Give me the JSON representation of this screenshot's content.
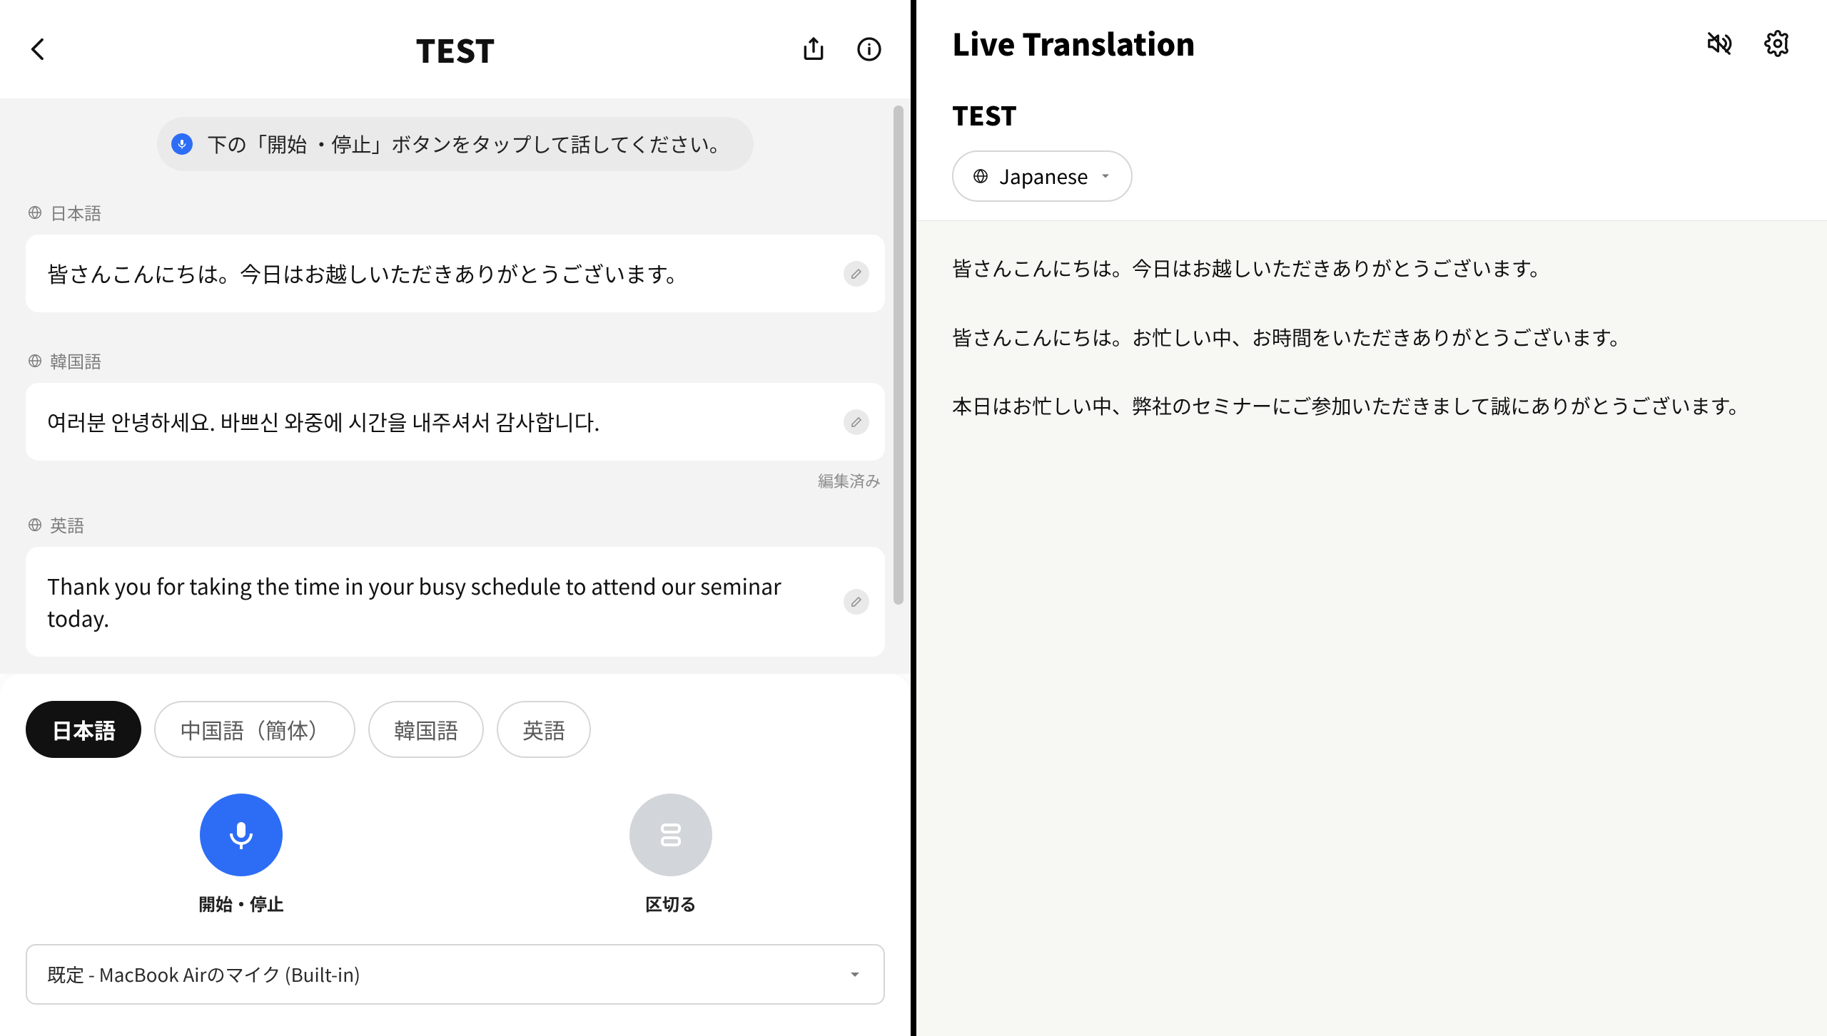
{
  "left": {
    "title": "TEST",
    "hint": "下の「開始 ・停止」ボタンをタップして話してください。",
    "messages": [
      {
        "lang_label": "日本語",
        "text": "皆さんこんにちは。今日はお越しいただきありがとうございます。",
        "edited": false
      },
      {
        "lang_label": "韓国語",
        "text": "여러분 안녕하세요. 바쁘신 와중에 시간을 내주셔서 감사합니다.",
        "edited": true
      },
      {
        "lang_label": "英語",
        "text": "Thank you for taking the time in your busy schedule to attend our seminar today.",
        "edited": false
      }
    ],
    "edited_label": "編集済み",
    "chips": [
      "日本語",
      "中国語（簡体）",
      "韓国語",
      "英語"
    ],
    "active_chip_index": 0,
    "rec_start_stop_label": "開始・停止",
    "rec_segment_label": "区切る",
    "mic_label": "既定 - MacBook Airのマイク (Built-in)"
  },
  "right": {
    "brand": "Live Translation",
    "title": "TEST",
    "language": "Japanese",
    "lines": [
      "皆さんこんにちは。今日はお越しいただきありがとうございます。",
      "皆さんこんにちは。お忙しい中、お時間をいただきありがとうございます。",
      "本日はお忙しい中、弊社のセミナーにご参加いただきまして誠にありがとうございます。"
    ]
  }
}
